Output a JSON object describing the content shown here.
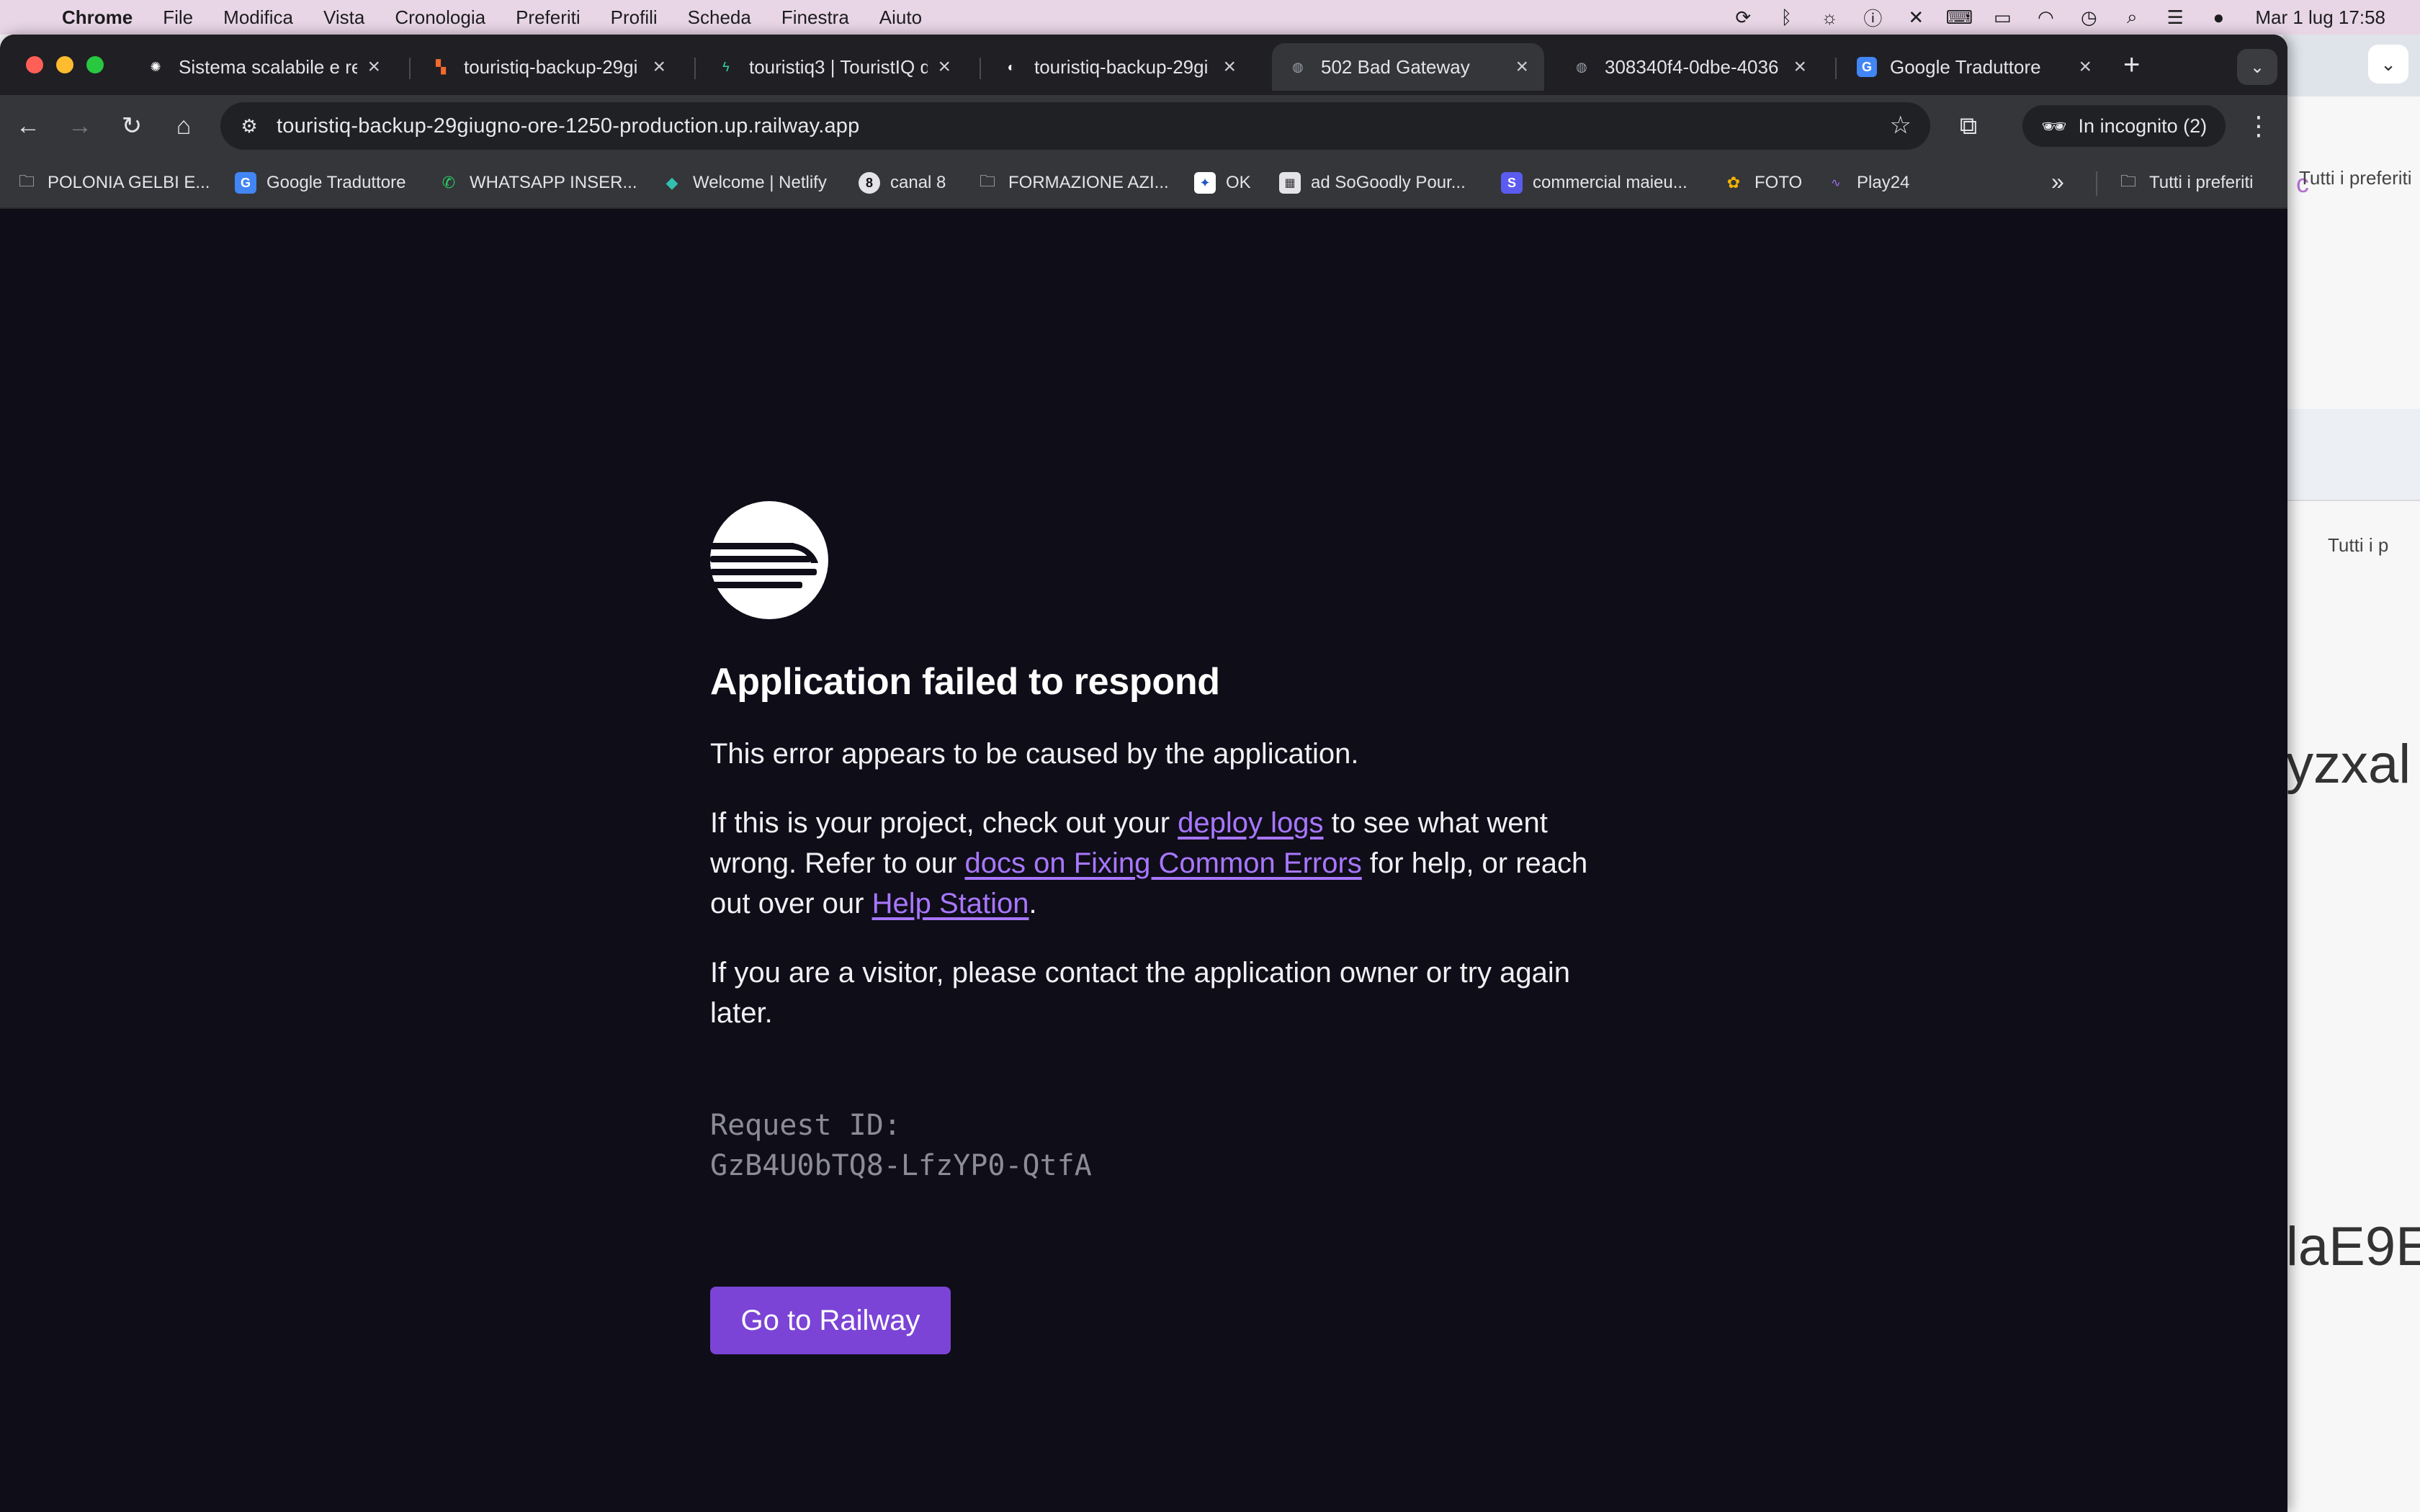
{
  "menubar": {
    "apple": "",
    "items": [
      "Chrome",
      "File",
      "Modifica",
      "Vista",
      "Cronologia",
      "Preferiti",
      "Profili",
      "Scheda",
      "Finestra",
      "Aiuto"
    ],
    "clock": "Mar 1 lug  17:58"
  },
  "tabs": [
    {
      "title": "Sistema scalabile e re",
      "favicon_color": "#ffffff",
      "favicon_glyph": "✺"
    },
    {
      "title": "touristiq-backup-29gi",
      "favicon_color": "#f26a2e",
      "favicon_glyph": "▚"
    },
    {
      "title": "touristiq3 | TouristIQ d",
      "favicon_color": "#34d399",
      "favicon_glyph": "ϟ"
    },
    {
      "title": "touristiq-backup-29gi",
      "favicon_color": "#ffffff",
      "favicon_glyph": "◐"
    },
    {
      "title": "502 Bad Gateway",
      "favicon_color": "#9aa0a6",
      "favicon_glyph": "◍",
      "active": true
    },
    {
      "title": "308340f4-0dbe-4036",
      "favicon_color": "#9aa0a6",
      "favicon_glyph": "◍"
    },
    {
      "title": "Google Traduttore",
      "favicon_color": "#4285f4",
      "favicon_glyph": "G"
    }
  ],
  "toolbar": {
    "url": "touristiq-backup-29giugno-ore-1250-production.up.railway.app",
    "incognito_label": "In incognito (2)"
  },
  "bookmarks": [
    {
      "label": "POLONIA GELBI E...",
      "icon": "folder-icon"
    },
    {
      "label": "Google Traduttore",
      "icon": "google-translate-icon"
    },
    {
      "label": "WHATSAPP INSER...",
      "icon": "whatsapp-icon"
    },
    {
      "label": "Welcome | Netlify",
      "icon": "netlify-icon"
    },
    {
      "label": "canal 8",
      "icon": "canal8-icon"
    },
    {
      "label": "FORMAZIONE AZI...",
      "icon": "folder-icon"
    },
    {
      "label": "OK",
      "icon": "ok-icon"
    },
    {
      "label": "ad SoGoodly Pour...",
      "icon": "sogoodly-icon"
    },
    {
      "label": "commercial maieu...",
      "icon": "s-icon"
    },
    {
      "label": "FOTO",
      "icon": "photos-icon"
    },
    {
      "label": "Play24",
      "icon": "play24-icon"
    }
  ],
  "bookmarks_all": "Tutti i preferiti",
  "page": {
    "heading": "Application failed to respond",
    "p1": "This error appears to be caused by the application.",
    "p2_a": "If this is your project, check out your ",
    "p2_link1": "deploy logs",
    "p2_b": " to see what went wrong. Refer to our ",
    "p2_link2": "docs on Fixing Common Errors",
    "p2_c": " for help, or reach out over our ",
    "p2_link3": "Help Station",
    "p2_d": ".",
    "p3": "If you are a visitor, please contact the application owner or try again later.",
    "request_label": "Request ID:",
    "request_id": "GzB4U0bTQ8-LfzYP0-QtfA",
    "button": "Go to Railway"
  },
  "background_window": {
    "bookmarks_fragment": "Tutti i preferiti",
    "bookmarks_fragment2": "Tutti i p",
    "text1": "yzxal",
    "text2": "laE9E",
    "avatar": "c"
  },
  "colors": {
    "page_bg": "#0f0d18",
    "accent": "#7b44d6",
    "link": "#a877ff"
  }
}
